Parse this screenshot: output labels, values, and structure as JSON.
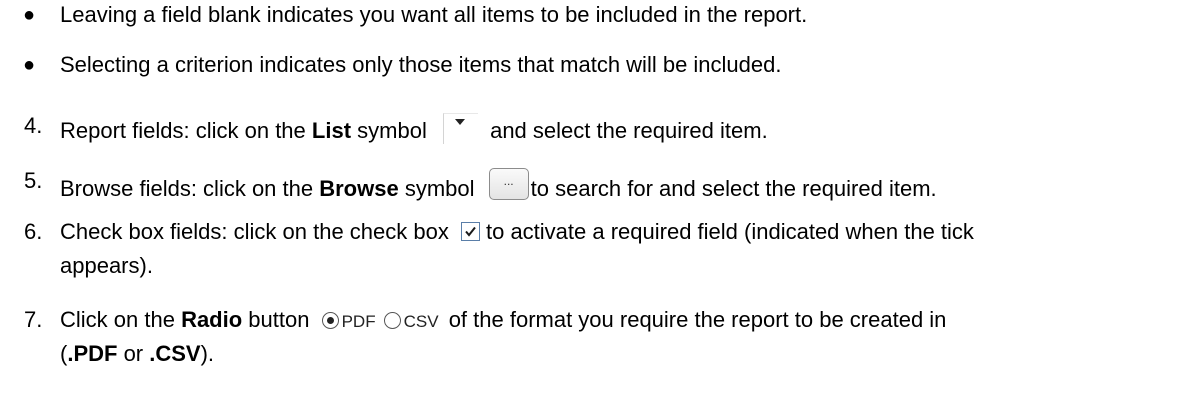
{
  "top_clipped": "…",
  "bullets": [
    "Leaving a field blank indicates you want all items to be included in the report.",
    "Selecting a criterion indicates only those items that match will be included."
  ],
  "steps": {
    "s4": {
      "num": "4.",
      "pre": "Report fields: click on the ",
      "bold": "List",
      "mid": " symbol",
      "post": "and select the required item."
    },
    "s5": {
      "num": "5.",
      "pre": "Browse fields: click on the ",
      "bold": "Browse",
      "mid": " symbol",
      "post": "to search for and select the required item.",
      "browse_label": "..."
    },
    "s6": {
      "num": "6.",
      "pre": "Check box fields: click on the check box",
      "post": "to activate a required field (indicated when the tick",
      "cont": "appears)."
    },
    "s7": {
      "num": "7.",
      "pre": "Click on the ",
      "bold": "Radio",
      "mid": " button",
      "post": "of the format you require the report to be created in",
      "cont_open": "(",
      "cont_b1": ".PDF",
      "cont_or": " or ",
      "cont_b2": ".CSV",
      "cont_close": ").",
      "radio1": "PDF",
      "radio2": "CSV"
    }
  },
  "icons": {
    "list": "dropdown-arrow-icon",
    "browse": "ellipsis-button",
    "check": "checkmark-icon",
    "radio": "radio-button"
  }
}
